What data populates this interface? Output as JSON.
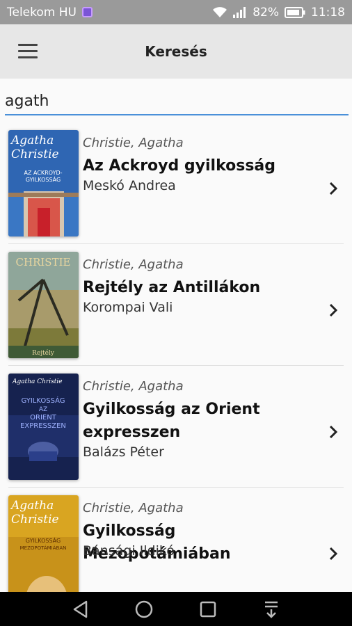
{
  "status": {
    "carrier": "Telekom HU",
    "battery": "82%",
    "time": "11:18"
  },
  "appbar": {
    "title": "Keresés",
    "menu_icon": "hamburger-menu-icon"
  },
  "search": {
    "value": "agath"
  },
  "results": [
    {
      "author": "Christie, Agatha",
      "title": "Az Ackroyd gyilkosság",
      "translator": "Meskó Andrea",
      "cover_text": [
        "Agatha",
        "Christie",
        "AZ ACKROYD-",
        "GYILKOSSÁG"
      ]
    },
    {
      "author": "Christie, Agatha",
      "title": "Rejtély az Antillákon",
      "translator": "Korompai Vali",
      "cover_text": [
        "CHRISTIE",
        "Rejtély"
      ]
    },
    {
      "author": "Christie, Agatha",
      "title": "Gyilkosság az Orient expresszen",
      "translator": "Balázs Péter",
      "cover_text": [
        "Agatha Christie",
        "GYILKOSSÁG",
        "AZ",
        "ORIENT",
        "EXPRESSZEN"
      ]
    },
    {
      "author": "Christie, Agatha",
      "title": "Gyilkosság Mezopotámiában",
      "translator": "Bánsági Ildikó",
      "cover_text": [
        "Agatha",
        "Christie",
        "GYILKOSSÁG",
        "MEZOPOTÁMIÁBAN"
      ]
    }
  ],
  "navbar": {
    "buttons": [
      "back-icon",
      "home-icon",
      "recents-icon",
      "notification-pulldown-icon"
    ]
  },
  "colors": {
    "statusbar": "#9a9a9a",
    "appbar": "#e7e7e7",
    "search_underline": "#4a90d9",
    "navbar": "#000000"
  }
}
